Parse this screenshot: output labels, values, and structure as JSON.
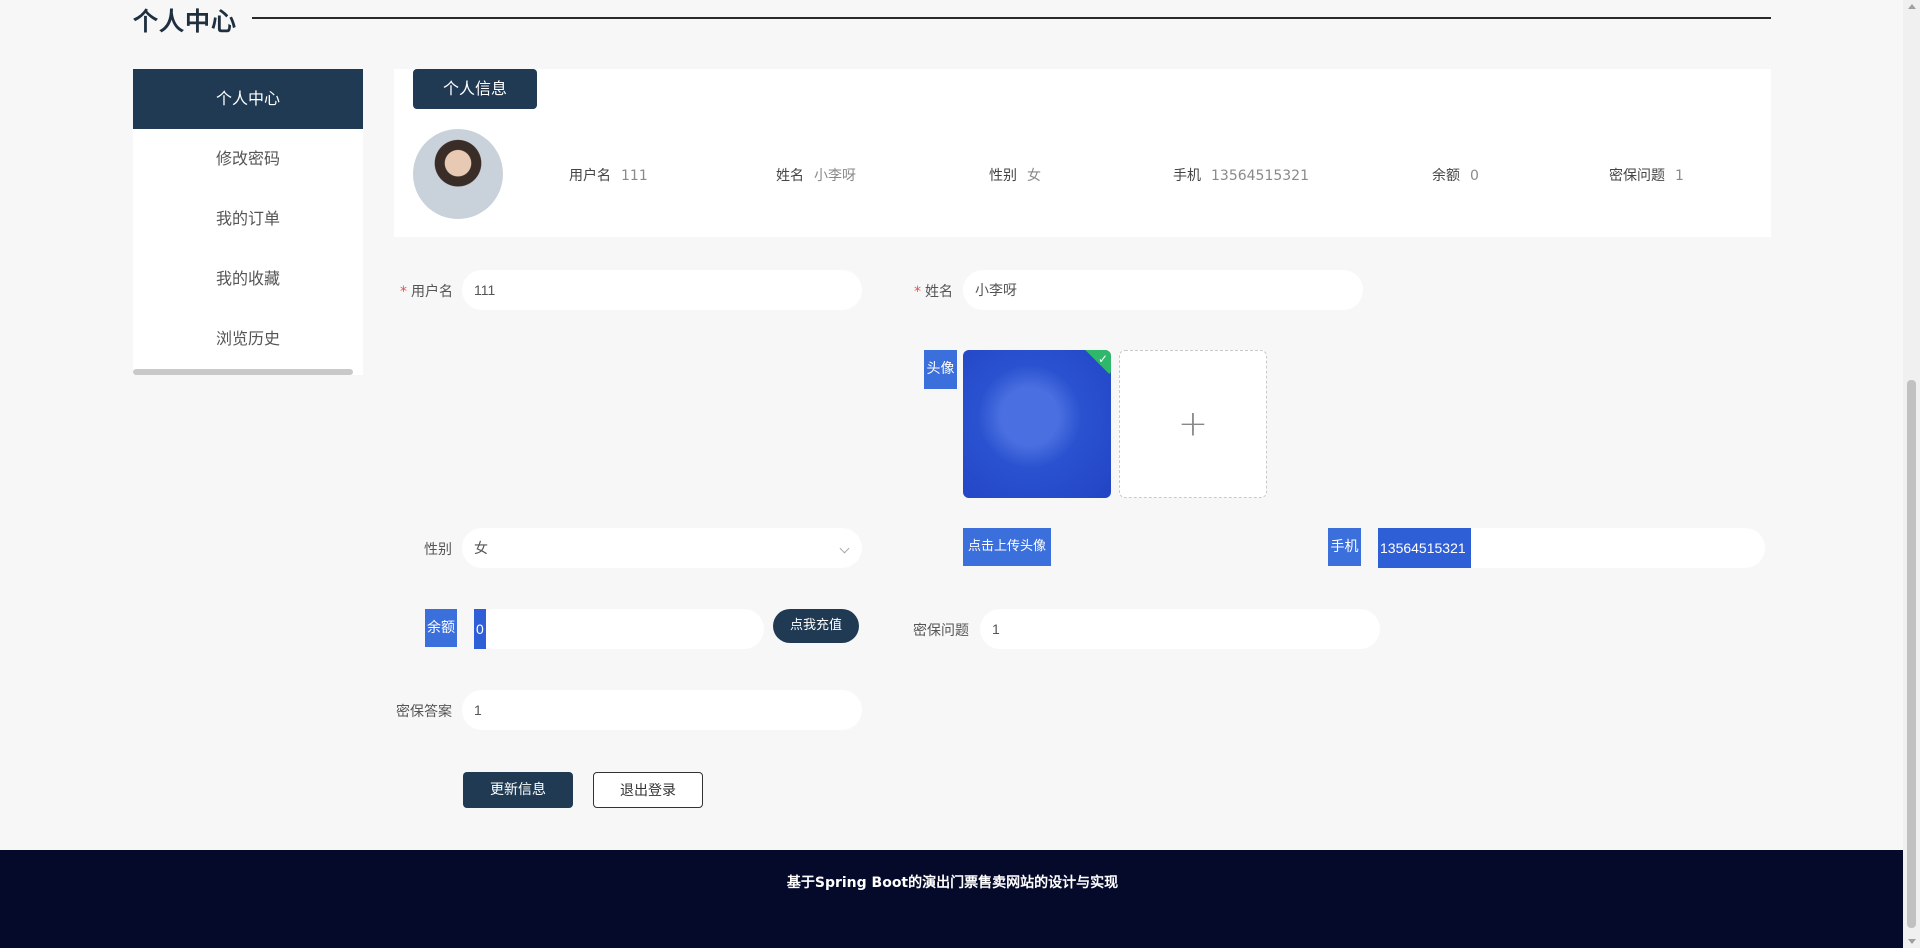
{
  "page": {
    "title": "个人中心"
  },
  "sidebar": {
    "items": [
      {
        "label": "个人中心"
      },
      {
        "label": "修改密码"
      },
      {
        "label": "我的订单"
      },
      {
        "label": "我的收藏"
      },
      {
        "label": "浏览历史"
      }
    ]
  },
  "info": {
    "tab": "个人信息",
    "username_label": "用户名",
    "username_value": "111",
    "name_label": "姓名",
    "name_value": "小李呀",
    "gender_label": "性别",
    "gender_value": "女",
    "phone_label": "手机",
    "phone_value": "13564515321",
    "balance_label": "余额",
    "balance_value": "0",
    "security_q_label": "密保问题",
    "security_q_value": "1"
  },
  "form": {
    "username_label": "用户名",
    "username_value": "111",
    "name_label": "姓名",
    "name_value": "小李呀",
    "avatar_label": "头像",
    "upload_button": "点击上传头像",
    "gender_label": "性别",
    "gender_value": "女",
    "phone_label": "手机",
    "phone_value": "13564515321",
    "balance_label": "余额",
    "balance_value": "0",
    "recharge_button": "点我充值",
    "security_q_label": "密保问题",
    "security_q_value": "1",
    "security_a_label": "密保答案",
    "security_a_value": "1",
    "update_button": "更新信息",
    "logout_button": "退出登录"
  },
  "footer": {
    "text": "基于Spring Boot的演出门票售卖网站的设计与实现"
  }
}
